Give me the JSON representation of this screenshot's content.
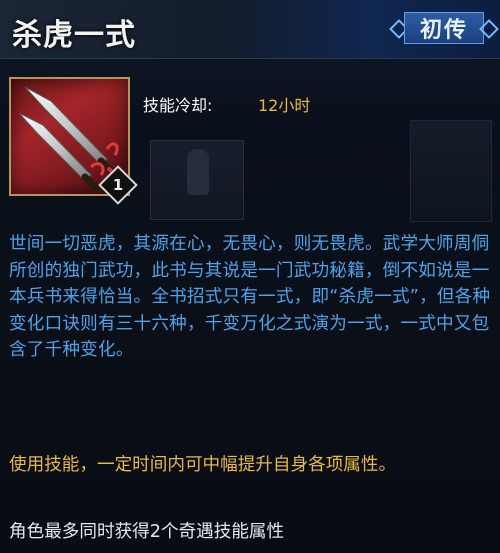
{
  "skill": {
    "title": "杀虎一式",
    "badge_label": "初传",
    "level": "1",
    "cooldown_label": "技能冷却:",
    "cooldown_value": "12小时",
    "description": "世间一切恶虎，其源在心，无畏心，则无畏虎。武学大师周侗所创的独门武功，此书与其说是一门武功秘籍，倒不如说是一本兵书来得恰当。全书招式只有一式，即“杀虎一式”，但各种变化口诀则有三十六种，千变万化之式演为一式，一式中又包含了千种变化。",
    "usage": "使用技能，一定时间内可中幅提升自身各项属性。",
    "limit_note": "角色最多同时获得2个奇遇技能属性"
  },
  "icons": {
    "skill_icon": "crossed-blades-icon",
    "badge_decor": "diamond-icon"
  },
  "colors": {
    "title": "#f2f2f2",
    "description": "#4ea3ea",
    "usage": "#e8b84a",
    "cooldown_value": "#e8b84a",
    "badge_bg": "#1b3f7d"
  }
}
